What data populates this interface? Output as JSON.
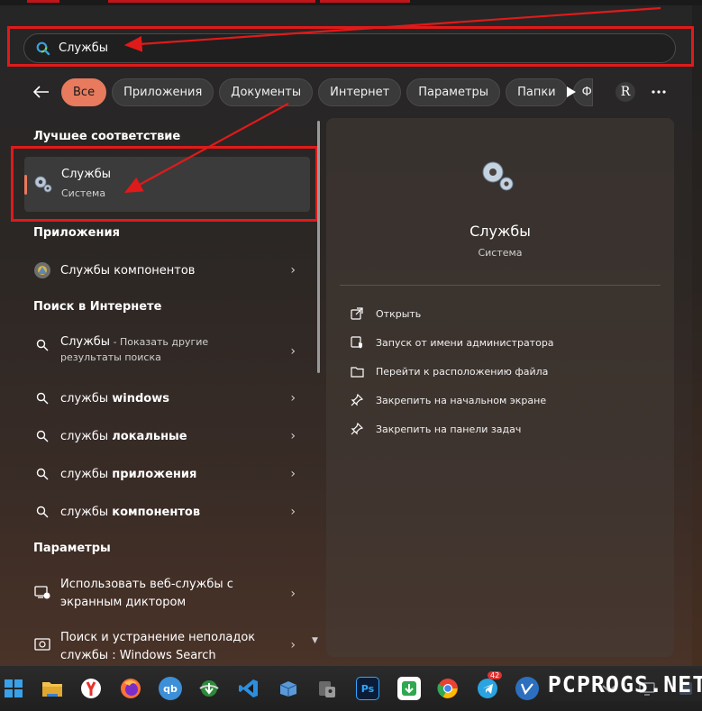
{
  "search": {
    "value": "Службы"
  },
  "filters": {
    "chips": [
      "Все",
      "Приложения",
      "Документы",
      "Интернет",
      "Параметры",
      "Папки",
      "Ф"
    ],
    "avatar_letter": "R",
    "active_color": "#e87a5d"
  },
  "left": {
    "best_match_title": "Лучшее соответствие",
    "best_match": {
      "name": "Службы",
      "type": "Система"
    },
    "apps_title": "Приложения",
    "apps": [
      {
        "label": "Службы компонентов"
      }
    ],
    "web_title": "Поиск в Интернете",
    "web_first": {
      "term": "Службы",
      "hint_line1": " - Показать другие",
      "hint_line2": "результаты поиска"
    },
    "web_suggestions": [
      {
        "prefix": "службы ",
        "bold": "windows"
      },
      {
        "prefix": "службы ",
        "bold": "локальные"
      },
      {
        "prefix": "службы ",
        "bold": "приложения"
      },
      {
        "prefix": "службы ",
        "bold": "компонентов"
      }
    ],
    "settings_title": "Параметры",
    "settings": [
      {
        "line1": "Использовать веб-службы с",
        "line2": "экранным диктором"
      },
      {
        "line1": "Поиск и устранение неполадок",
        "line2": "службы : Windows Search"
      }
    ]
  },
  "detail": {
    "title": "Службы",
    "subtitle": "Система",
    "actions": [
      {
        "label": "Открыть",
        "icon": "open-external-icon"
      },
      {
        "label": "Запуск от имени администратора",
        "icon": "admin-shield-icon"
      },
      {
        "label": "Перейти к расположению файла",
        "icon": "folder-icon"
      },
      {
        "label": "Закрепить на начальном экране",
        "icon": "pin-icon"
      },
      {
        "label": "Закрепить на панели задач",
        "icon": "pin-icon"
      }
    ]
  },
  "taskbar": {
    "icons": [
      "start-icon",
      "file-explorer-icon",
      "yandex-browser-icon",
      "firefox-icon",
      "qbittorrent-icon",
      "internet-download-manager-icon",
      "vscode-icon",
      "virtualbox-icon",
      "security-app-icon",
      "photoshop-icon",
      "download-app-icon",
      "chrome-icon",
      "telegram-icon",
      "vk-icon"
    ],
    "photoshop_label": "Ps",
    "qbittorrent_label": "qb",
    "telegram_badge": "42"
  },
  "watermark": "PCPROGS.NET",
  "colors": {
    "annotation_red": "#e01a1a",
    "accent": "#e87a5d"
  }
}
